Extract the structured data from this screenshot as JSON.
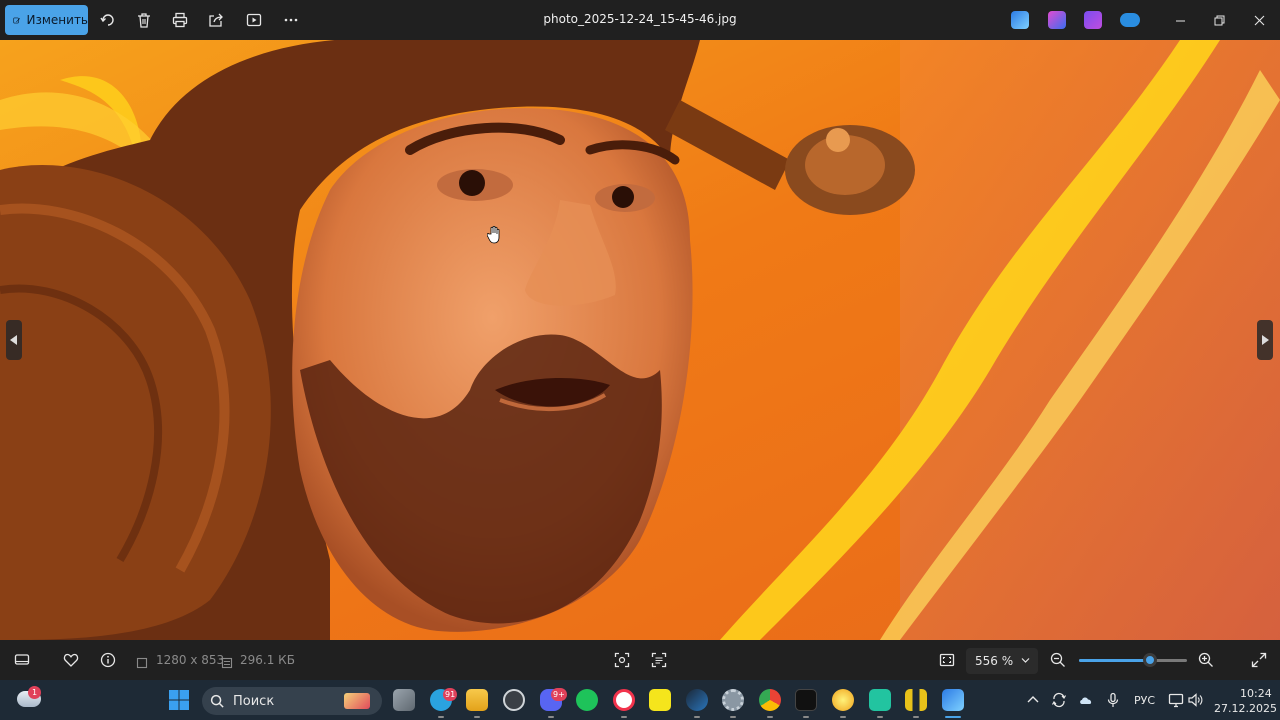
{
  "toolbar": {
    "edit_label": "Изменить",
    "icons": [
      "edit-icon",
      "rotate-icon",
      "delete-icon",
      "print-icon",
      "share-icon",
      "slideshow-icon",
      "more-icon"
    ]
  },
  "window": {
    "title": "photo_2025-12-24_15-45-46.jpg",
    "controls": [
      "minimize-icon",
      "restore-icon",
      "close-icon"
    ]
  },
  "status": {
    "dimensions": "1280 x 853",
    "file_size": "296.1 КБ",
    "zoom_value": "556 %",
    "zoom_level": 0.66
  },
  "taskbar": {
    "search_label": "Поиск",
    "weather_badge": "1",
    "telegram_badge": "91",
    "discord_badge": "9+",
    "language": "РУС",
    "time": "10:24",
    "date": "27.12.2025"
  },
  "colors": {
    "accent": "#4aa3e8",
    "toolbar_bg": "#202020",
    "taskbar_bg": "#1e2a36",
    "fire_orange": "#f07a16",
    "fire_yellow": "#ffd21c"
  }
}
